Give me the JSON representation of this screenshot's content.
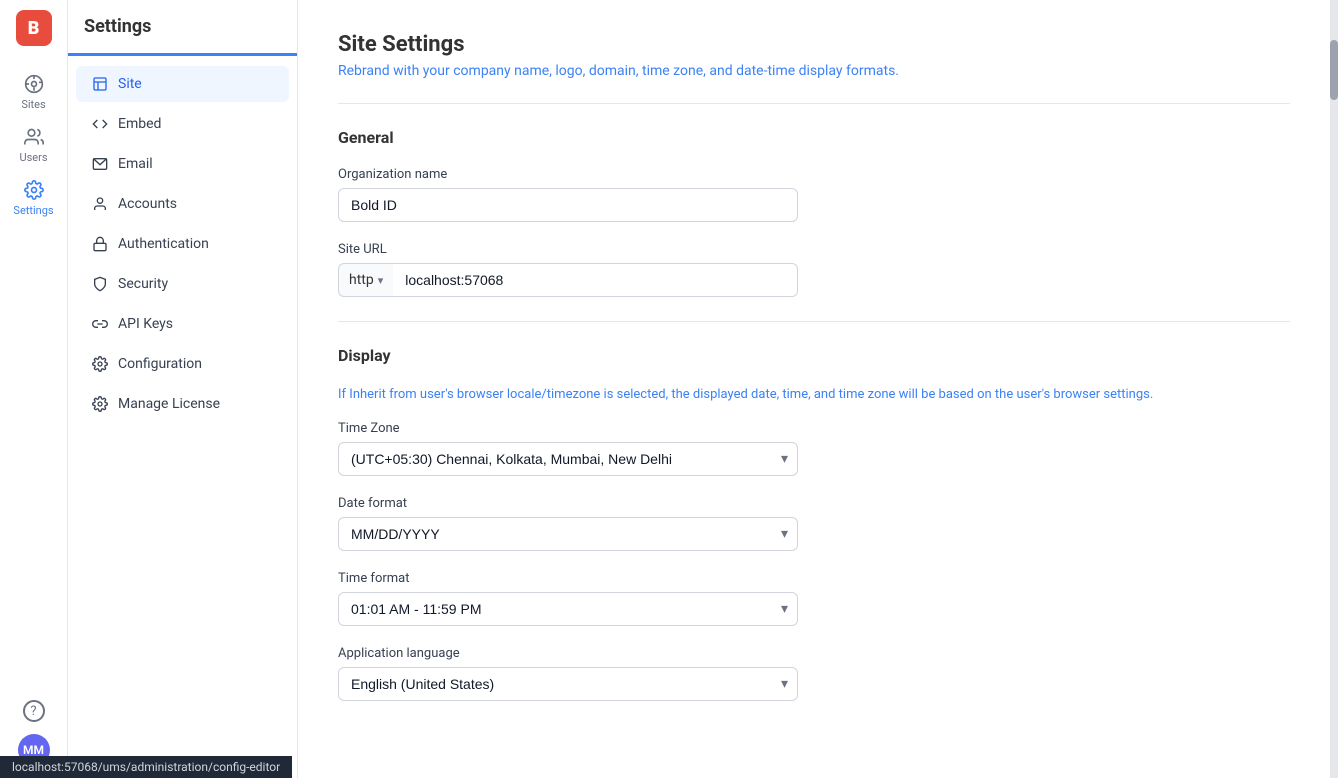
{
  "app": {
    "logo": "B",
    "status_bar_url": "localhost:57068/ums/administration/config-editor"
  },
  "icon_nav": {
    "sites_label": "Sites",
    "users_label": "Users",
    "settings_label": "Settings"
  },
  "sidebar": {
    "title": "Settings",
    "items": [
      {
        "id": "site",
        "label": "Site",
        "active": true
      },
      {
        "id": "embed",
        "label": "Embed"
      },
      {
        "id": "email",
        "label": "Email"
      },
      {
        "id": "accounts",
        "label": "Accounts"
      },
      {
        "id": "authentication",
        "label": "Authentication"
      },
      {
        "id": "security",
        "label": "Security"
      },
      {
        "id": "api-keys",
        "label": "API Keys"
      },
      {
        "id": "configuration",
        "label": "Configuration"
      },
      {
        "id": "manage-license",
        "label": "Manage License"
      }
    ]
  },
  "main": {
    "page_title": "Site Settings",
    "page_subtitle_before": "Rebrand with your company name, logo, domain, time zone, and date-time display formats.",
    "general_section": "General",
    "org_name_label": "Organization name",
    "org_name_value": "Bold ID",
    "site_url_label": "Site URL",
    "site_url_protocol": "http",
    "site_url_protocol_arrow": "▾",
    "site_url_host": "localhost:57068",
    "display_section": "Display",
    "display_note": "If Inherit from user's browser locale/timezone is selected, the displayed date, time, and time zone will be based on the user's browser settings.",
    "timezone_label": "Time Zone",
    "timezone_value": "(UTC+05:30) Chennai, Kolkata, Mumbai, New Delhi",
    "date_format_label": "Date format",
    "date_format_value": "MM/DD/YYYY",
    "time_format_label": "Time format",
    "time_format_value": "01:01 AM - 11:59 PM",
    "app_language_label": "Application language",
    "app_language_value": "English (United States)"
  },
  "help_icon": "?",
  "user_avatar": "MM"
}
